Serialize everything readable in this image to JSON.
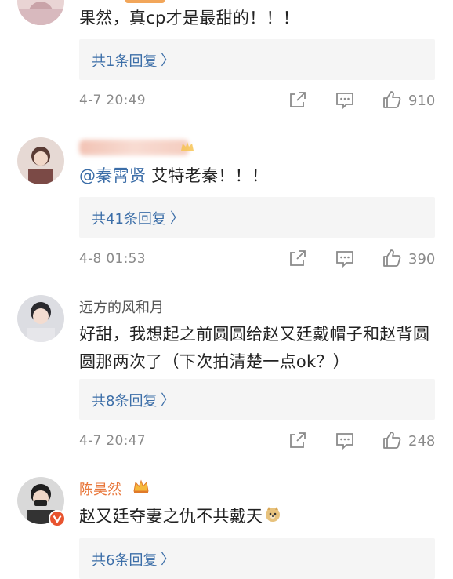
{
  "comments": [
    {
      "text": "果然，真cp才是最甜的！！！",
      "reply_label": "共1条回复",
      "time": "4-7 20:49",
      "likes": "910"
    },
    {
      "mention": "@秦霄贤",
      "text": " 艾特老秦！！！",
      "reply_label": "共41条回复",
      "time": "4-8 01:53",
      "likes": "390"
    },
    {
      "username": "远方的风和月",
      "text": "好甜，我想起之前圆圆给赵又廷戴帽子和赵背圆圆那两次了（下次拍清楚一点ok？）",
      "reply_label": "共8条回复",
      "time": "4-7 20:47",
      "likes": "248"
    },
    {
      "username": "陈昊然",
      "text": "赵又廷夺妻之仇不共戴天",
      "reply_label": "共6条回复"
    }
  ],
  "chevron": "〉",
  "colors": {
    "link": "#3c6ea8",
    "meta": "#8a8a8a",
    "orange_name": "#e8763a"
  },
  "icons": [
    "share-icon",
    "comment-icon",
    "like-icon",
    "crown-badge-icon",
    "verified-badge-icon",
    "doge-emoji-icon"
  ]
}
